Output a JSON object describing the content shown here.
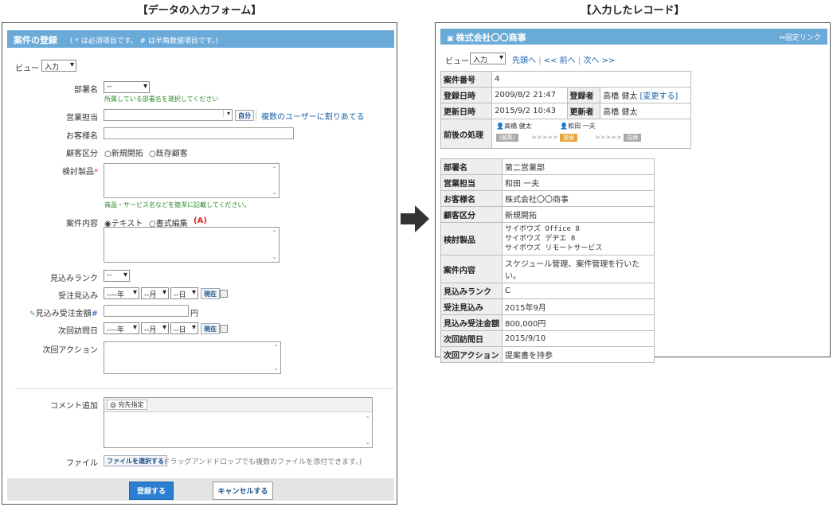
{
  "headings": {
    "form": "【データの入力フォーム】",
    "record": "【入力したレコード】"
  },
  "form": {
    "title": "案件の登録",
    "note": "( * は必須項目です。 # は半角数値項目です。)",
    "view_label": "ビュー",
    "view_value": "入力",
    "fields": {
      "department": {
        "label": "部署名",
        "value": "--",
        "hint": "所属している部署名を選択してください"
      },
      "sales_rep": {
        "label": "営業担当",
        "self_button": "自分",
        "multi_link": "複数のユーザーに割りあてる"
      },
      "customer": {
        "label": "お客様名"
      },
      "customer_type": {
        "label": "顧客区分",
        "opt1": "○新規開拓",
        "opt2": "○既存顧客"
      },
      "products": {
        "label": "検討製品",
        "required_mark": "*",
        "hint": "商品・サービス名などを簡潔に記載してください。"
      },
      "content": {
        "label": "案件内容",
        "opt1": "◉テキスト",
        "opt2": "○書式編集",
        "format_icon": "(A)"
      },
      "rank": {
        "label": "見込みランク",
        "value": "--"
      },
      "expected_order": {
        "label": "受注見込み",
        "year": "----年",
        "month": "--月",
        "day": "--日",
        "now_button": "現在"
      },
      "amount": {
        "label": "見込み受注金額",
        "num_mark": "#",
        "unit": "円"
      },
      "next_visit": {
        "label": "次回訪問日",
        "year": "----年",
        "month": "--月",
        "day": "--日",
        "now_button": "現在"
      },
      "next_action": {
        "label": "次回アクション"
      }
    },
    "comment": {
      "label": "コメント追加",
      "recipient_button": "宛先指定"
    },
    "file": {
      "label": "ファイル",
      "select_button": "ファイルを選択する",
      "note": "(ドラッグアンドドロップでも複数のファイルを添付できます。)"
    },
    "buttons": {
      "submit": "登録する",
      "cancel": "キャンセルする"
    }
  },
  "record": {
    "title": "株式会社〇〇商事",
    "permalink": "固定リンク",
    "view_label": "ビュー",
    "view_value": "入力",
    "nav": {
      "first": "先頭へ",
      "prev": "<< 前へ",
      "next": "次へ >>"
    },
    "meta": {
      "number_label": "案件番号",
      "number": "4",
      "created_label": "登録日時",
      "created": "2009/8/2 21:47",
      "creator_label": "登録者",
      "creator": "高橋 健太",
      "change": "[変更する]",
      "updated_label": "更新日時",
      "updated": "2015/9/2 10:43",
      "updater_label": "更新者",
      "updater": "高橋 健太",
      "process_label": "前後の処理",
      "process_user1": "高橋 健太",
      "process_user2": "和田 一夫",
      "step1": "(編集)",
      "step2": "提案",
      "step3": "見積",
      "arrows": ">>>>>"
    },
    "fields": [
      {
        "label": "部署名",
        "value": "第二営業部"
      },
      {
        "label": "営業担当",
        "value": "和田 一夫"
      },
      {
        "label": "お客様名",
        "value": "株式会社〇〇商事"
      },
      {
        "label": "顧客区分",
        "value": "新規開拓"
      },
      {
        "label": "検討製品",
        "lines": [
          "サイボウズ Office 8",
          "サイボウズ デヂエ 8",
          "サイボウズ リモートサービス"
        ]
      },
      {
        "label": "案件内容",
        "value": "スケジュール管理、案件管理を行いたい。"
      },
      {
        "label": "見込みランク",
        "value": "C"
      },
      {
        "label": "受注見込み",
        "value": "2015年9月"
      },
      {
        "label": "見込み受注金額",
        "value": "800,000円"
      },
      {
        "label": "次回訪問日",
        "value": "2015/9/10"
      },
      {
        "label": "次回アクション",
        "value": "提案書を持参"
      }
    ]
  },
  "colors": {
    "title_bar": "#6aaad9",
    "primary_button": "#2a7fd0",
    "required": "#e23333",
    "link": "#1a5fa8"
  }
}
